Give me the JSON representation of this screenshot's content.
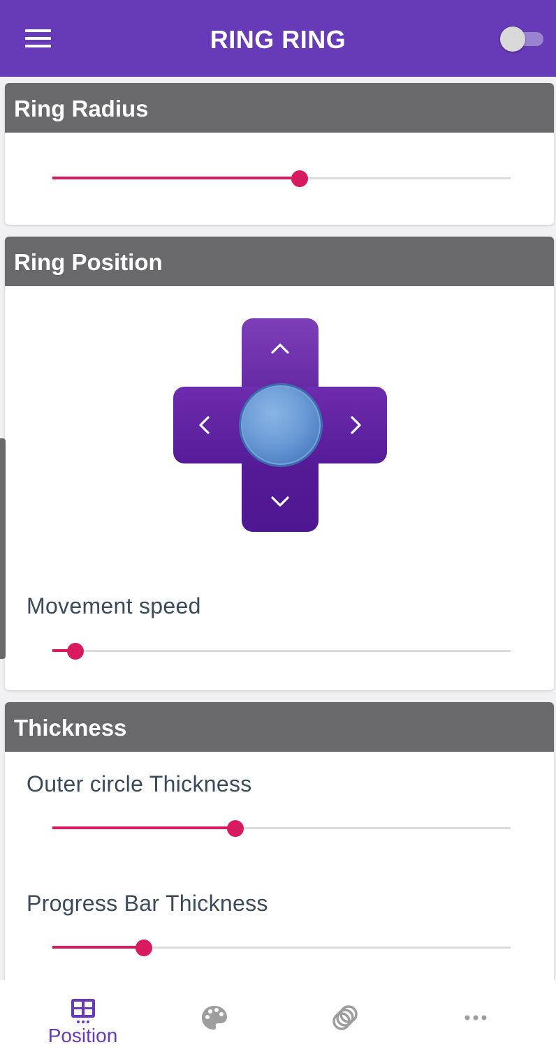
{
  "app": {
    "title": "RING RING",
    "toggle_on": false,
    "accent_color": "#673ab7",
    "slider_color": "#d81b60"
  },
  "cards": {
    "radius": {
      "header": "Ring Radius",
      "slider_value": 0.54
    },
    "position": {
      "header": "Ring Position",
      "speed_label": "Movement speed",
      "speed_value": 0.05
    },
    "thickness": {
      "header": "Thickness",
      "outer_label": "Outer circle Thickness",
      "outer_value": 0.4,
      "progress_label": "Progress Bar Thickness",
      "progress_value": 0.2
    }
  },
  "dpad": {
    "up_icon": "chevron-up-icon",
    "down_icon": "chevron-down-icon",
    "left_icon": "chevron-left-icon",
    "right_icon": "chevron-right-icon"
  },
  "bottom_nav": {
    "active": "position",
    "items": [
      {
        "id": "position",
        "icon": "grid-icon",
        "label": "Position"
      },
      {
        "id": "colors",
        "icon": "palette-icon",
        "label": ""
      },
      {
        "id": "rings",
        "icon": "rings-icon",
        "label": ""
      },
      {
        "id": "more",
        "icon": "more-icon",
        "label": ""
      }
    ]
  }
}
